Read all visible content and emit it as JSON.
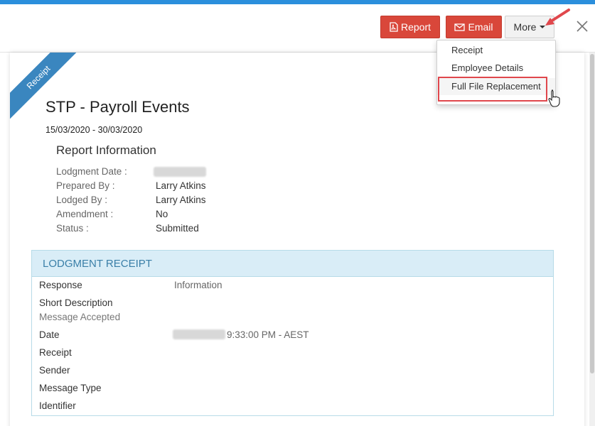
{
  "toolbar": {
    "report_label": "Report",
    "email_label": "Email",
    "more_label": "More"
  },
  "dropdown": {
    "items": [
      {
        "label": "Receipt"
      },
      {
        "label": "Employee Details"
      },
      {
        "label": "Full File Replacement"
      }
    ]
  },
  "ribbon_label": "Receipt",
  "report": {
    "title": "STP - Payroll Events",
    "period": "15/03/2020 - 30/03/2020",
    "section_title": "Report Information",
    "fields": [
      {
        "label": "Lodgment Date :",
        "value": ""
      },
      {
        "label": "Prepared By :",
        "value": "Larry Atkins"
      },
      {
        "label": "Lodged By :",
        "value": "Larry Atkins"
      },
      {
        "label": "Amendment :",
        "value": "No"
      },
      {
        "label": "Status :",
        "value": "Submitted"
      }
    ]
  },
  "lodgment_receipt": {
    "heading": "LODGMENT RECEIPT",
    "response_label": "Response",
    "response_value": "Information",
    "short_desc_label": "Short Description",
    "short_desc_value": "Message Accepted",
    "date_label": "Date",
    "date_time": "9:33:00 PM - AEST",
    "receipt_label": "Receipt",
    "sender_label": "Sender",
    "message_type_label": "Message Type",
    "identifier_label": "Identifier"
  },
  "colors": {
    "accent_blue": "#2b8fdc",
    "button_red": "#d9473a",
    "highlight_red": "#e0474c",
    "receipt_header_bg": "#d9edf7"
  }
}
